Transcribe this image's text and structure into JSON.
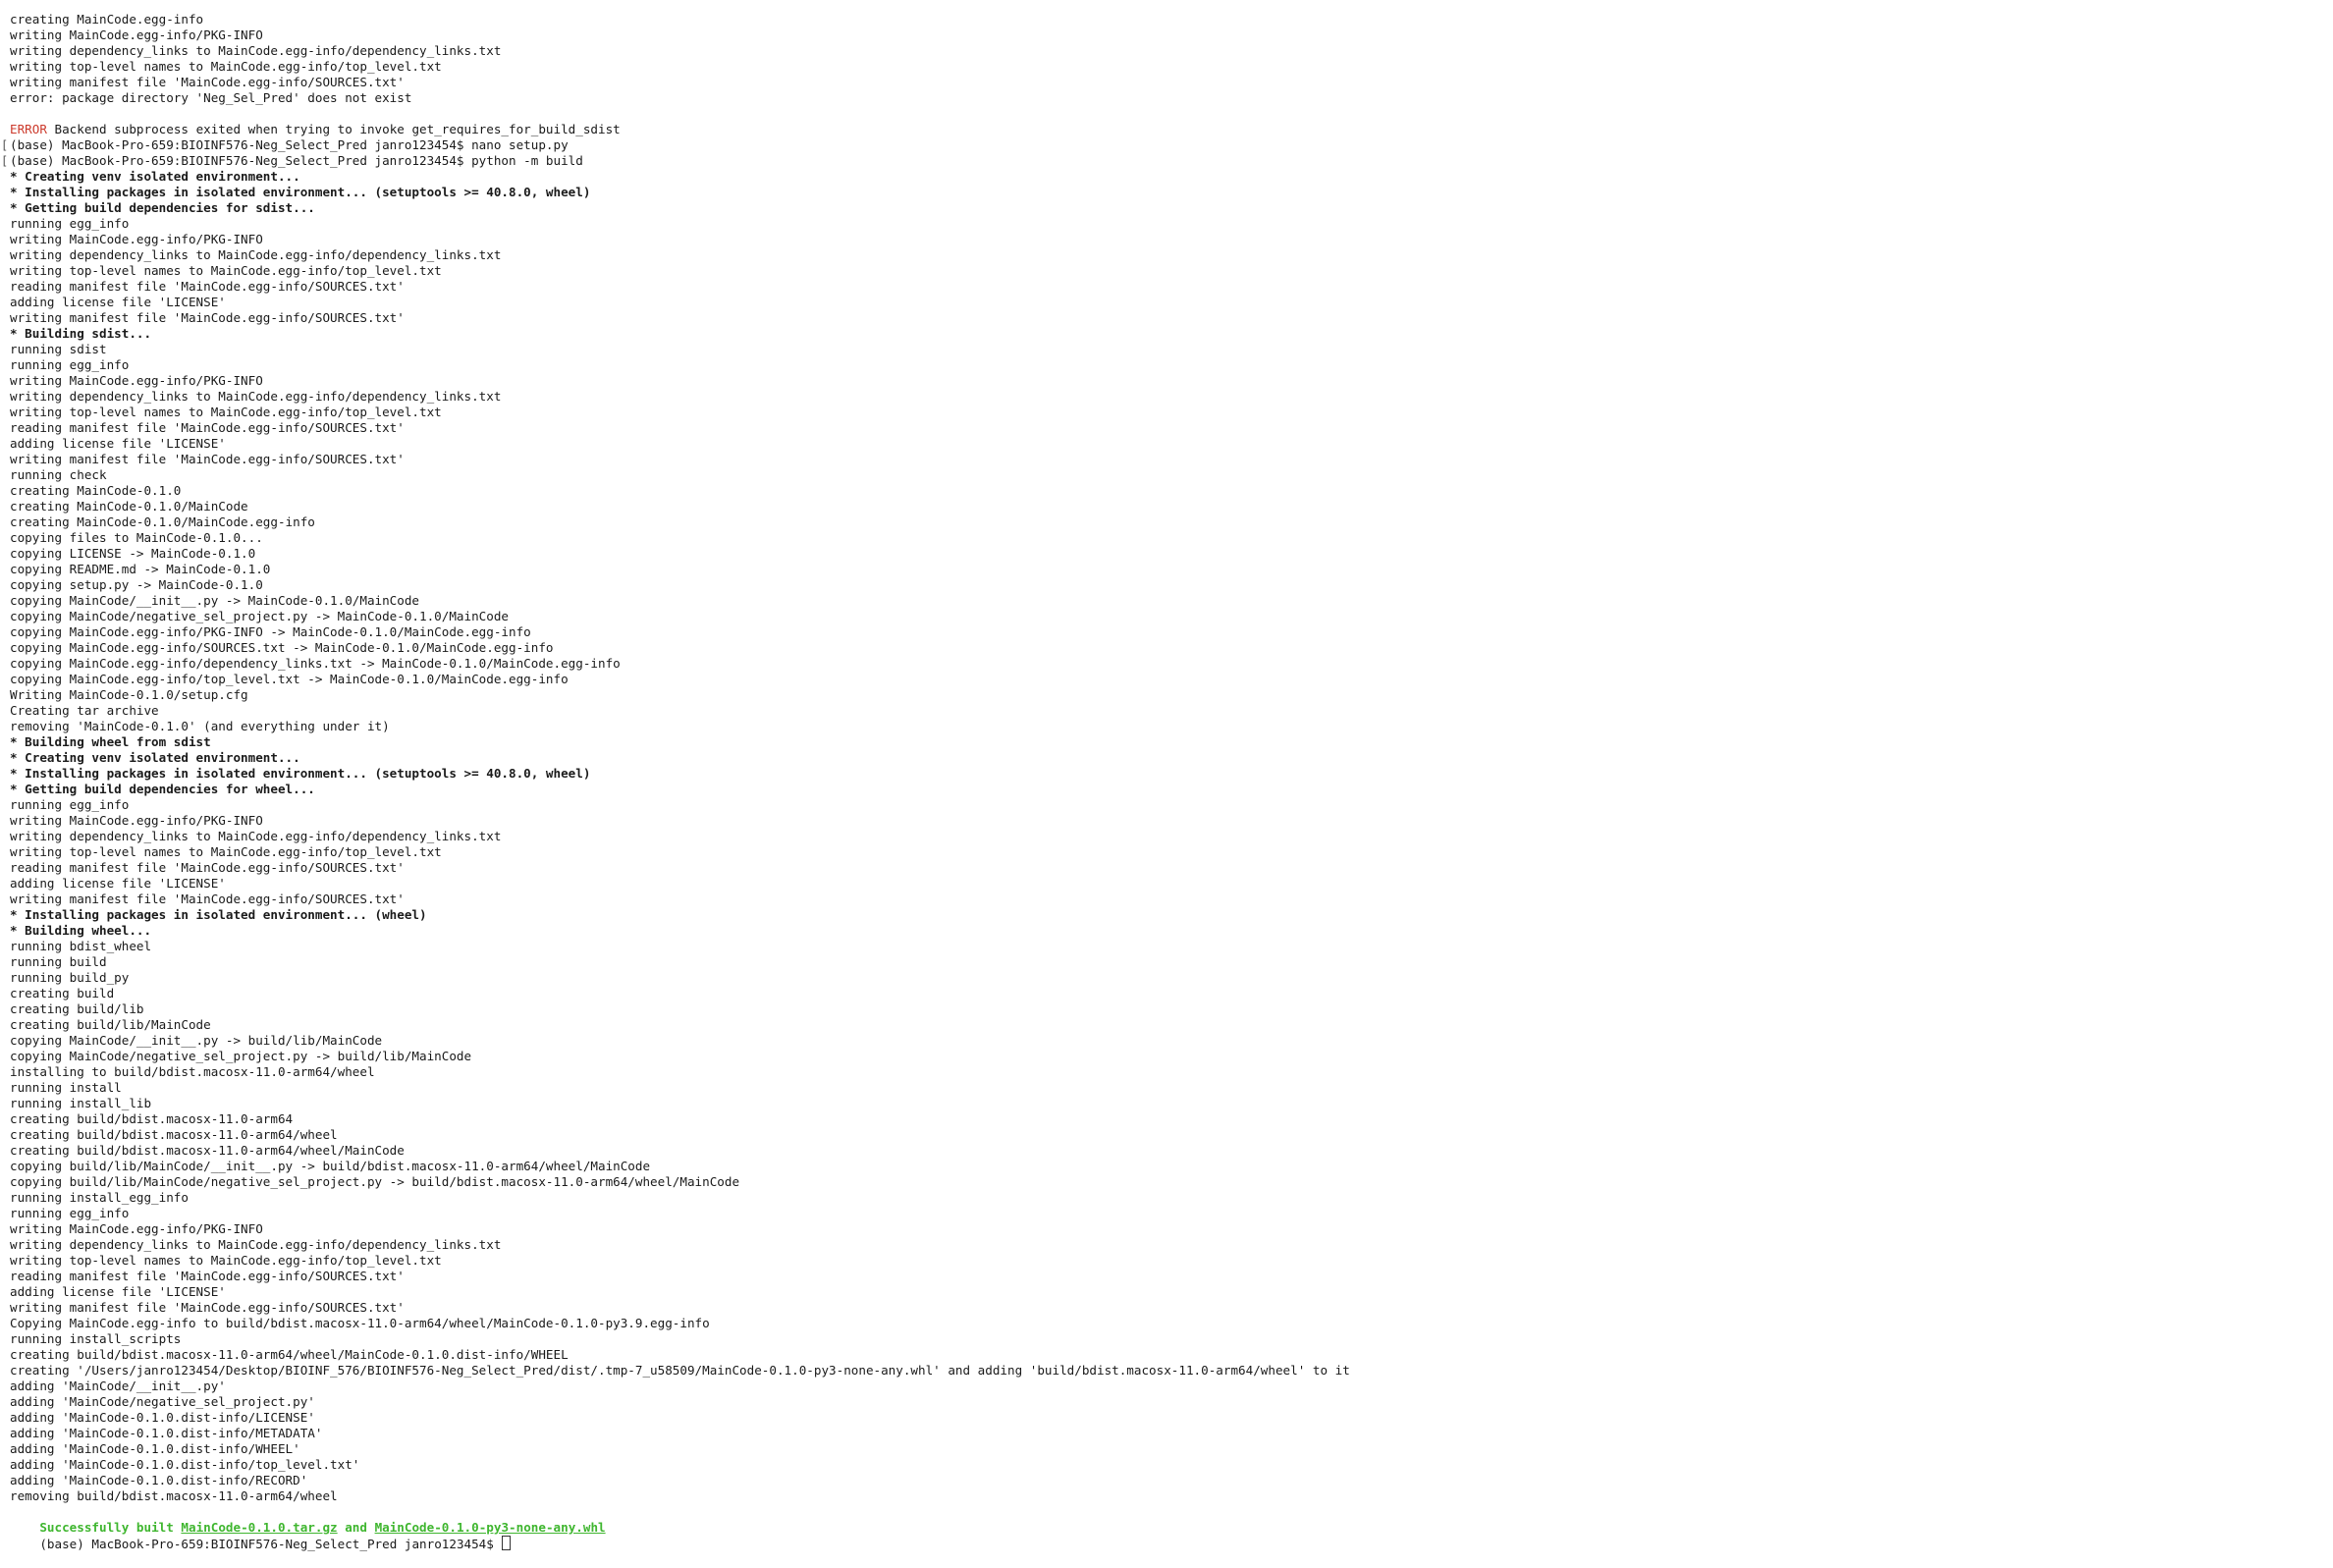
{
  "terminal": {
    "lines": [
      {
        "text": "creating MainCode.egg-info"
      },
      {
        "text": "writing MainCode.egg-info/PKG-INFO"
      },
      {
        "text": "writing dependency_links to MainCode.egg-info/dependency_links.txt"
      },
      {
        "text": "writing top-level names to MainCode.egg-info/top_level.txt"
      },
      {
        "text": "writing manifest file 'MainCode.egg-info/SOURCES.txt'"
      },
      {
        "text": "error: package directory 'Neg_Sel_Pred' does not exist"
      },
      {
        "text": ""
      },
      {
        "prefix": "ERROR",
        "text": " Backend subprocess exited when trying to invoke get_requires_for_build_sdist"
      },
      {
        "text": "(base) MacBook-Pro-659:BIOINF576-Neg_Select_Pred janro123454$ nano setup.py",
        "marker": "["
      },
      {
        "text": "(base) MacBook-Pro-659:BIOINF576-Neg_Select_Pred janro123454$ python -m build",
        "marker": "["
      },
      {
        "text": "* Creating venv isolated environment...",
        "bold": true
      },
      {
        "text": "* Installing packages in isolated environment... (setuptools >= 40.8.0, wheel)",
        "bold": true
      },
      {
        "text": "* Getting build dependencies for sdist...",
        "bold": true
      },
      {
        "text": "running egg_info"
      },
      {
        "text": "writing MainCode.egg-info/PKG-INFO"
      },
      {
        "text": "writing dependency_links to MainCode.egg-info/dependency_links.txt"
      },
      {
        "text": "writing top-level names to MainCode.egg-info/top_level.txt"
      },
      {
        "text": "reading manifest file 'MainCode.egg-info/SOURCES.txt'"
      },
      {
        "text": "adding license file 'LICENSE'"
      },
      {
        "text": "writing manifest file 'MainCode.egg-info/SOURCES.txt'"
      },
      {
        "text": "* Building sdist...",
        "bold": true
      },
      {
        "text": "running sdist"
      },
      {
        "text": "running egg_info"
      },
      {
        "text": "writing MainCode.egg-info/PKG-INFO"
      },
      {
        "text": "writing dependency_links to MainCode.egg-info/dependency_links.txt"
      },
      {
        "text": "writing top-level names to MainCode.egg-info/top_level.txt"
      },
      {
        "text": "reading manifest file 'MainCode.egg-info/SOURCES.txt'"
      },
      {
        "text": "adding license file 'LICENSE'"
      },
      {
        "text": "writing manifest file 'MainCode.egg-info/SOURCES.txt'"
      },
      {
        "text": "running check"
      },
      {
        "text": "creating MainCode-0.1.0"
      },
      {
        "text": "creating MainCode-0.1.0/MainCode"
      },
      {
        "text": "creating MainCode-0.1.0/MainCode.egg-info"
      },
      {
        "text": "copying files to MainCode-0.1.0..."
      },
      {
        "text": "copying LICENSE -> MainCode-0.1.0"
      },
      {
        "text": "copying README.md -> MainCode-0.1.0"
      },
      {
        "text": "copying setup.py -> MainCode-0.1.0"
      },
      {
        "text": "copying MainCode/__init__.py -> MainCode-0.1.0/MainCode"
      },
      {
        "text": "copying MainCode/negative_sel_project.py -> MainCode-0.1.0/MainCode"
      },
      {
        "text": "copying MainCode.egg-info/PKG-INFO -> MainCode-0.1.0/MainCode.egg-info"
      },
      {
        "text": "copying MainCode.egg-info/SOURCES.txt -> MainCode-0.1.0/MainCode.egg-info"
      },
      {
        "text": "copying MainCode.egg-info/dependency_links.txt -> MainCode-0.1.0/MainCode.egg-info"
      },
      {
        "text": "copying MainCode.egg-info/top_level.txt -> MainCode-0.1.0/MainCode.egg-info"
      },
      {
        "text": "Writing MainCode-0.1.0/setup.cfg"
      },
      {
        "text": "Creating tar archive"
      },
      {
        "text": "removing 'MainCode-0.1.0' (and everything under it)"
      },
      {
        "text": "* Building wheel from sdist",
        "bold": true
      },
      {
        "text": "* Creating venv isolated environment...",
        "bold": true
      },
      {
        "text": "* Installing packages in isolated environment... (setuptools >= 40.8.0, wheel)",
        "bold": true
      },
      {
        "text": "* Getting build dependencies for wheel...",
        "bold": true
      },
      {
        "text": "running egg_info"
      },
      {
        "text": "writing MainCode.egg-info/PKG-INFO"
      },
      {
        "text": "writing dependency_links to MainCode.egg-info/dependency_links.txt"
      },
      {
        "text": "writing top-level names to MainCode.egg-info/top_level.txt"
      },
      {
        "text": "reading manifest file 'MainCode.egg-info/SOURCES.txt'"
      },
      {
        "text": "adding license file 'LICENSE'"
      },
      {
        "text": "writing manifest file 'MainCode.egg-info/SOURCES.txt'"
      },
      {
        "text": "* Installing packages in isolated environment... (wheel)",
        "bold": true
      },
      {
        "text": "* Building wheel...",
        "bold": true
      },
      {
        "text": "running bdist_wheel"
      },
      {
        "text": "running build"
      },
      {
        "text": "running build_py"
      },
      {
        "text": "creating build"
      },
      {
        "text": "creating build/lib"
      },
      {
        "text": "creating build/lib/MainCode"
      },
      {
        "text": "copying MainCode/__init__.py -> build/lib/MainCode"
      },
      {
        "text": "copying MainCode/negative_sel_project.py -> build/lib/MainCode"
      },
      {
        "text": "installing to build/bdist.macosx-11.0-arm64/wheel"
      },
      {
        "text": "running install"
      },
      {
        "text": "running install_lib"
      },
      {
        "text": "creating build/bdist.macosx-11.0-arm64"
      },
      {
        "text": "creating build/bdist.macosx-11.0-arm64/wheel"
      },
      {
        "text": "creating build/bdist.macosx-11.0-arm64/wheel/MainCode"
      },
      {
        "text": "copying build/lib/MainCode/__init__.py -> build/bdist.macosx-11.0-arm64/wheel/MainCode"
      },
      {
        "text": "copying build/lib/MainCode/negative_sel_project.py -> build/bdist.macosx-11.0-arm64/wheel/MainCode"
      },
      {
        "text": "running install_egg_info"
      },
      {
        "text": "running egg_info"
      },
      {
        "text": "writing MainCode.egg-info/PKG-INFO"
      },
      {
        "text": "writing dependency_links to MainCode.egg-info/dependency_links.txt"
      },
      {
        "text": "writing top-level names to MainCode.egg-info/top_level.txt"
      },
      {
        "text": "reading manifest file 'MainCode.egg-info/SOURCES.txt'"
      },
      {
        "text": "adding license file 'LICENSE'"
      },
      {
        "text": "writing manifest file 'MainCode.egg-info/SOURCES.txt'"
      },
      {
        "text": "Copying MainCode.egg-info to build/bdist.macosx-11.0-arm64/wheel/MainCode-0.1.0-py3.9.egg-info"
      },
      {
        "text": "running install_scripts"
      },
      {
        "text": "creating build/bdist.macosx-11.0-arm64/wheel/MainCode-0.1.0.dist-info/WHEEL"
      },
      {
        "text": "creating '/Users/janro123454/Desktop/BIOINF_576/BIOINF576-Neg_Select_Pred/dist/.tmp-7_u58509/MainCode-0.1.0-py3-none-any.whl' and adding 'build/bdist.macosx-11.0-arm64/wheel' to it"
      },
      {
        "text": "adding 'MainCode/__init__.py'"
      },
      {
        "text": "adding 'MainCode/negative_sel_project.py'"
      },
      {
        "text": "adding 'MainCode-0.1.0.dist-info/LICENSE'"
      },
      {
        "text": "adding 'MainCode-0.1.0.dist-info/METADATA'"
      },
      {
        "text": "adding 'MainCode-0.1.0.dist-info/WHEEL'"
      },
      {
        "text": "adding 'MainCode-0.1.0.dist-info/top_level.txt'"
      },
      {
        "text": "adding 'MainCode-0.1.0.dist-info/RECORD'"
      },
      {
        "text": "removing build/bdist.macosx-11.0-arm64/wheel"
      }
    ],
    "success": {
      "prefix": "Successfully built ",
      "artifact_1": "MainCode-0.1.0.tar.gz",
      "joiner": " and ",
      "artifact_2": "MainCode-0.1.0-py3-none-any.whl"
    },
    "prompt": "(base) MacBook-Pro-659:BIOINF576-Neg_Select_Pred janro123454$ ",
    "colors": {
      "background": "#ffffff",
      "text": "#1a1a1a",
      "error": "#cc3a2c",
      "success": "#3fb62f"
    }
  }
}
